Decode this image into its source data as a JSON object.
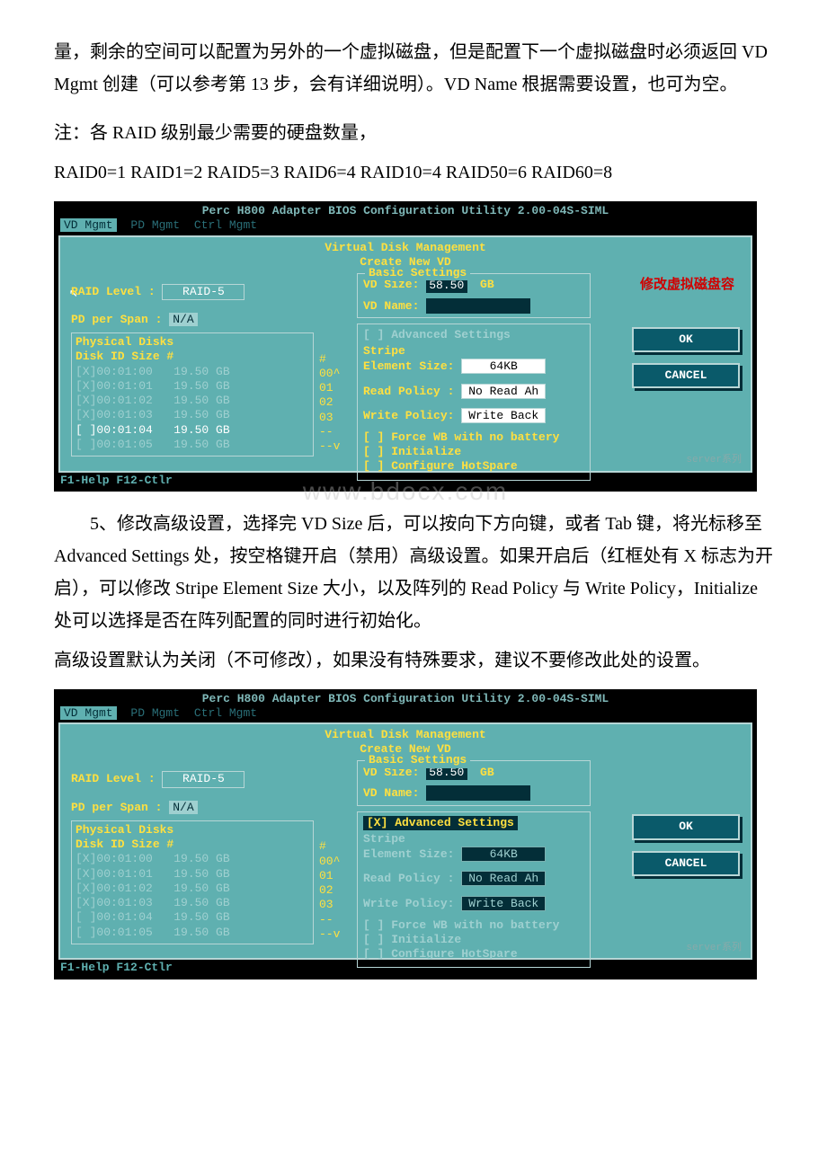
{
  "para1": "量，剩余的空间可以配置为另外的一个虚拟磁盘，但是配置下一个虚拟磁盘时必须返回 VD Mgmt 创建（可以参考第 13 步，会有详细说明）。VD Name 根据需要设置，也可为空。",
  "para2a": "注：各 RAID 级别最少需要的硬盘数量，",
  "para2b": "RAID0=1  RAID1=2  RAID5=3  RAID6=4 RAID10=4  RAID50=6 RAID60=8",
  "para3": "5、修改高级设置，选择完 VD Size 后，可以按向下方向键，或者 Tab 键，将光标移至 Advanced Settings 处，按空格键开启（禁用）高级设置。如果开启后（红框处有 X 标志为开启），可以修改 Stripe Element Size 大小，以及阵列的 Read Policy 与 Write Policy，Initialize 处可以选择是否在阵列配置的同时进行初始化。",
  "para4": "高级设置默认为关闭（不可修改），如果没有特殊要求，建议不要修改此处的设置。",
  "bios": {
    "title": "Perc H800 Adapter BIOS Configuration Utility 2.00-04S-SIML",
    "menu": {
      "active": "VD Mgmt",
      "m2": "PD Mgmt",
      "m3": "Ctrl Mgmt"
    },
    "h1": "Virtual Disk Management",
    "h2": "Create New VD",
    "raid_label": "RAID Level :",
    "raid_value": "RAID-5",
    "pd_span_label": "PD per Span :",
    "pd_span_value": "N/A",
    "pd_title": "Physical Disks",
    "pd_headers": "Disk ID       Size        #",
    "hash_col": "#\n00^\n01\n02\n03\n--\n--v",
    "basic_title": "Basic Settings",
    "vd_size_label": "VD Size:",
    "vd_size_value": "58.50",
    "vd_size_unit": "GB",
    "vd_name_label": "VD Name:",
    "adv_mark_off": "[ ] Advanced Settings",
    "adv_mark_on": "[X] Advanced Settings",
    "stripe_label": "Stripe",
    "elem_label": "Element Size:",
    "elem_value": "64KB",
    "read_label": "Read Policy :",
    "read_value": "No Read Ah",
    "write_label": "Write Policy:",
    "write_value": "Write Back",
    "chk1": "[ ] Force WB with no battery",
    "chk2": "[ ] Initialize",
    "chk3": "[ ] Configure HotSpare",
    "ok": "OK",
    "cancel": "CANCEL",
    "footer": "F1-Help F12-Ctlr",
    "annot": "修改虚拟磁盘容",
    "watermark": "server系列",
    "wm_center": "www.bdocx.com",
    "disks1": [
      {
        "id": "[X]00:01:00",
        "sz": "19.50 GB",
        "sel": false
      },
      {
        "id": "[X]00:01:01",
        "sz": "19.50 GB",
        "sel": false
      },
      {
        "id": "[X]00:01:02",
        "sz": "19.50 GB",
        "sel": false
      },
      {
        "id": "[X]00:01:03",
        "sz": "19.50 GB",
        "sel": false
      },
      {
        "id": "[ ]00:01:04",
        "sz": "19.50 GB",
        "sel": true
      },
      {
        "id": "[ ]00:01:05",
        "sz": "19.50 GB",
        "sel": false
      }
    ],
    "disks2": [
      {
        "id": "[X]00:01:00",
        "sz": "19.50 GB",
        "sel": false
      },
      {
        "id": "[X]00:01:01",
        "sz": "19.50 GB",
        "sel": false
      },
      {
        "id": "[X]00:01:02",
        "sz": "19.50 GB",
        "sel": false
      },
      {
        "id": "[X]00:01:03",
        "sz": "19.50 GB",
        "sel": false
      },
      {
        "id": "[ ]00:01:04",
        "sz": "19.50 GB",
        "sel": false
      },
      {
        "id": "[ ]00:01:05",
        "sz": "19.50 GB",
        "sel": false
      }
    ]
  }
}
